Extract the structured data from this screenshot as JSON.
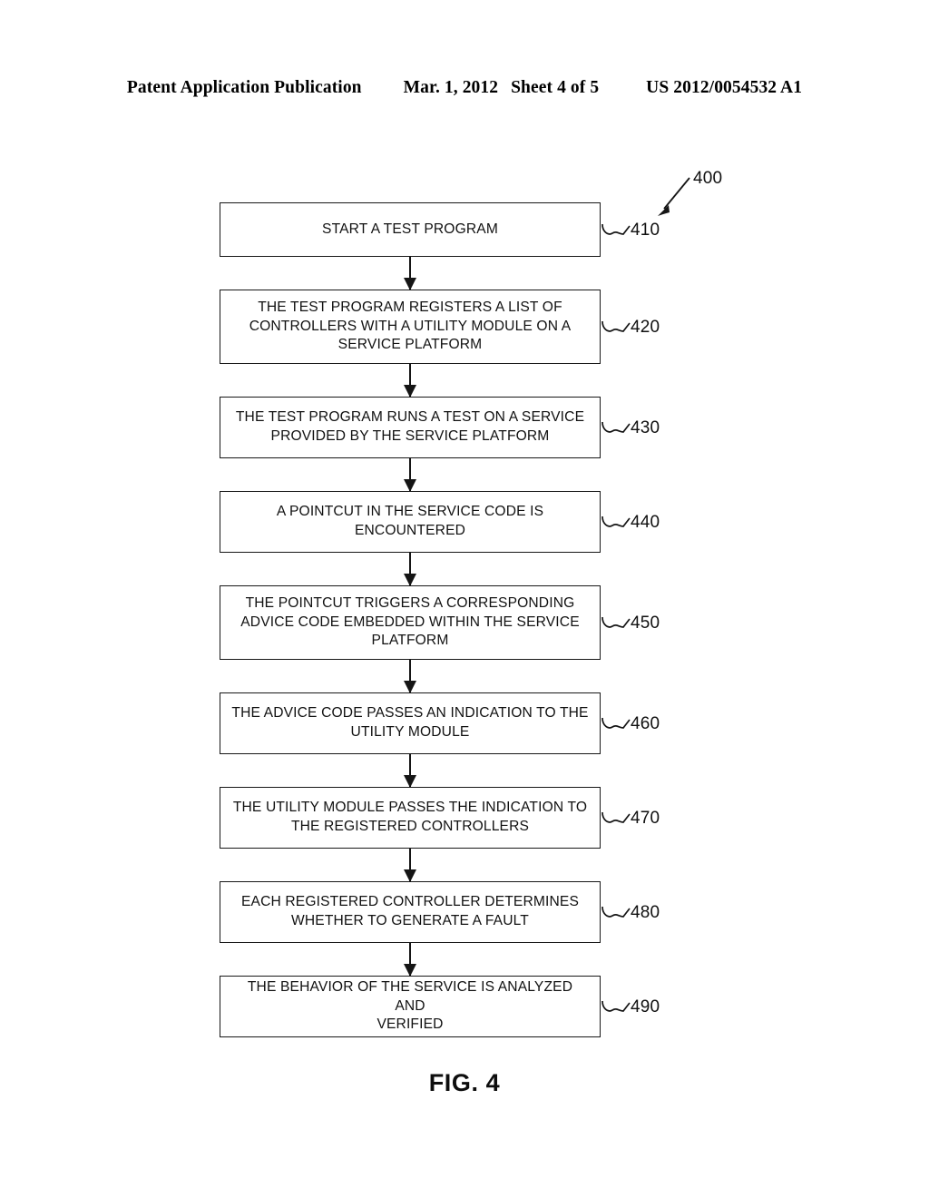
{
  "header": {
    "publication": "Patent Application Publication",
    "date": "Mar. 1, 2012",
    "sheet": "Sheet 4 of 5",
    "patent_number": "US 2012/0054532 A1"
  },
  "figure": {
    "caption": "FIG. 4",
    "diagram_reference": "400",
    "type": "flowchart"
  },
  "flowchart": {
    "steps": [
      {
        "ref": "410",
        "text": "START A TEST PROGRAM",
        "lines": 1
      },
      {
        "ref": "420",
        "text": "THE TEST PROGRAM REGISTERS A LIST OF\nCONTROLLERS WITH A UTILITY MODULE ON A\nSERVICE PLATFORM",
        "lines": 3
      },
      {
        "ref": "430",
        "text": "THE TEST PROGRAM RUNS A TEST ON A SERVICE\nPROVIDED BY THE SERVICE PLATFORM",
        "lines": 2
      },
      {
        "ref": "440",
        "text": "A POINTCUT IN THE SERVICE CODE IS\nENCOUNTERED",
        "lines": 2
      },
      {
        "ref": "450",
        "text": "THE POINTCUT TRIGGERS A CORRESPONDING\nADVICE CODE EMBEDDED WITHIN THE SERVICE\nPLATFORM",
        "lines": 3
      },
      {
        "ref": "460",
        "text": "THE ADVICE CODE PASSES AN INDICATION TO THE\nUTILITY MODULE",
        "lines": 2
      },
      {
        "ref": "470",
        "text": "THE UTILITY MODULE PASSES THE INDICATION TO\nTHE REGISTERED CONTROLLERS",
        "lines": 2
      },
      {
        "ref": "480",
        "text": "EACH REGISTERED CONTROLLER DETERMINES\nWHETHER TO GENERATE A FAULT",
        "lines": 2
      },
      {
        "ref": "490",
        "text": "THE BEHAVIOR OF THE SERVICE IS ANALYZED AND\nVERIFIED",
        "lines": 2
      }
    ]
  },
  "style": {
    "line_color": "#151515",
    "text_color": "#111111",
    "background": "#ffffff"
  }
}
